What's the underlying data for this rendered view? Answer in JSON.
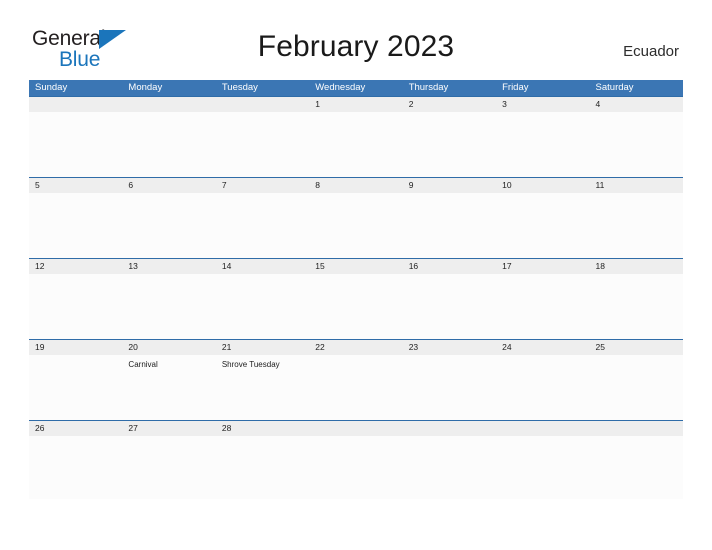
{
  "brand": {
    "name_part1": "General",
    "name_part2": "Blue",
    "triangle_icon": "triangle-icon",
    "accent_color": "#1b75bb"
  },
  "header": {
    "title": "February 2023",
    "country": "Ecuador"
  },
  "calendar": {
    "header_bg": "#3b76b4",
    "band_bg": "#eeeeee",
    "rule_color": "#2f6ca8",
    "weekdays": [
      "Sunday",
      "Monday",
      "Tuesday",
      "Wednesday",
      "Thursday",
      "Friday",
      "Saturday"
    ],
    "weeks": [
      [
        {
          "day": "",
          "events": []
        },
        {
          "day": "",
          "events": []
        },
        {
          "day": "",
          "events": []
        },
        {
          "day": "1",
          "events": []
        },
        {
          "day": "2",
          "events": []
        },
        {
          "day": "3",
          "events": []
        },
        {
          "day": "4",
          "events": []
        }
      ],
      [
        {
          "day": "5",
          "events": []
        },
        {
          "day": "6",
          "events": []
        },
        {
          "day": "7",
          "events": []
        },
        {
          "day": "8",
          "events": []
        },
        {
          "day": "9",
          "events": []
        },
        {
          "day": "10",
          "events": []
        },
        {
          "day": "11",
          "events": []
        }
      ],
      [
        {
          "day": "12",
          "events": []
        },
        {
          "day": "13",
          "events": []
        },
        {
          "day": "14",
          "events": []
        },
        {
          "day": "15",
          "events": []
        },
        {
          "day": "16",
          "events": []
        },
        {
          "day": "17",
          "events": []
        },
        {
          "day": "18",
          "events": []
        }
      ],
      [
        {
          "day": "19",
          "events": []
        },
        {
          "day": "20",
          "events": [
            "Carnival"
          ]
        },
        {
          "day": "21",
          "events": [
            "Shrove Tuesday"
          ]
        },
        {
          "day": "22",
          "events": []
        },
        {
          "day": "23",
          "events": []
        },
        {
          "day": "24",
          "events": []
        },
        {
          "day": "25",
          "events": []
        }
      ],
      [
        {
          "day": "26",
          "events": []
        },
        {
          "day": "27",
          "events": []
        },
        {
          "day": "28",
          "events": []
        },
        {
          "day": "",
          "events": []
        },
        {
          "day": "",
          "events": []
        },
        {
          "day": "",
          "events": []
        },
        {
          "day": "",
          "events": []
        }
      ]
    ]
  }
}
